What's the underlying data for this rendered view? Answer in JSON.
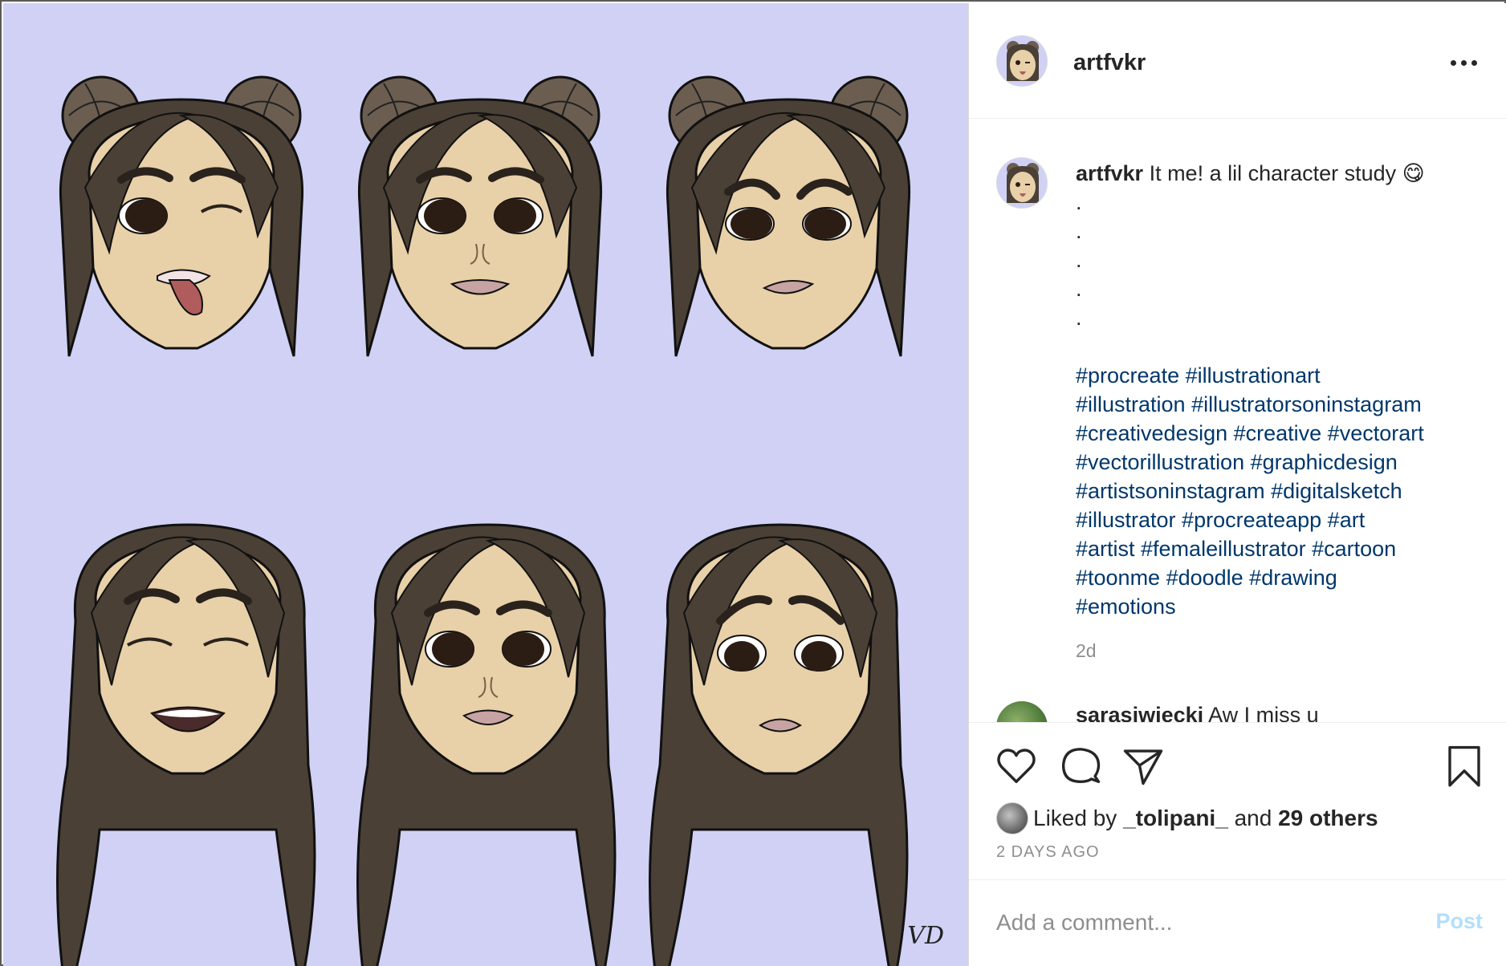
{
  "post": {
    "username": "artfvkr",
    "caption_text": "It me! a lil character study 😋",
    "caption_dots": [
      ".",
      ".",
      ".",
      ".",
      "."
    ],
    "hashtag_lines": [
      "#procreate #illustrationart",
      "#illustration #illustratorsoninstagram",
      "#creativedesign #creative #vectorart",
      "#vectorillustration #graphicdesign",
      "#artistsoninstagram #digitalsketch",
      "#illustrator #procreateapp #art",
      "#artist #femaleillustrator #cartoon",
      "#toonme #doodle #drawing",
      "#emotions"
    ],
    "relative_time": "2d"
  },
  "next_comment": {
    "username": "sarasiwiecki",
    "text": "Aw I miss u"
  },
  "likes": {
    "prefix": "Liked by",
    "user": "_tolipani_",
    "middle": "and",
    "others": "29 others"
  },
  "date_label": "2 DAYS AGO",
  "comment_box": {
    "placeholder": "Add a comment...",
    "post_label": "Post"
  },
  "icons": {
    "more": "more-options-icon",
    "like": "heart-icon",
    "comment": "comment-icon",
    "share": "share-icon",
    "save": "bookmark-icon"
  },
  "colors": {
    "art_background": "#d0d1f5",
    "hashtag": "#00376b",
    "muted": "#8e8e8e",
    "post_disabled": "#b2dffc"
  }
}
